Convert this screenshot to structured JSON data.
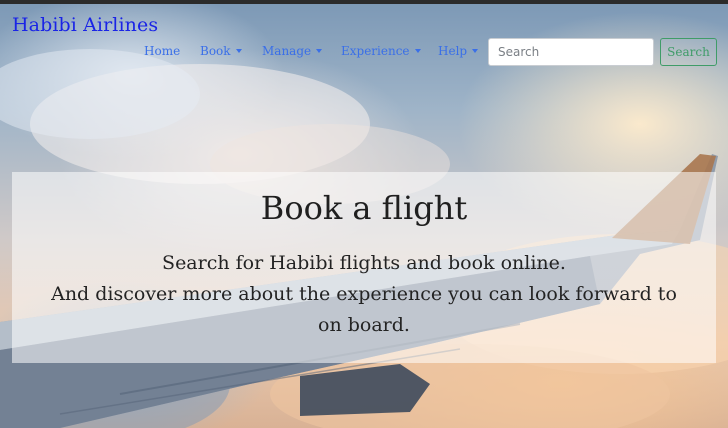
{
  "brand": {
    "name": "Habibi Airlines"
  },
  "nav": {
    "items": [
      {
        "label": "Home",
        "dropdown": false
      },
      {
        "label": "Book",
        "dropdown": true
      },
      {
        "label": "Manage",
        "dropdown": true
      },
      {
        "label": "Experience",
        "dropdown": true
      },
      {
        "label": "Help",
        "dropdown": true
      }
    ]
  },
  "search": {
    "placeholder": "Search",
    "value": "",
    "button_label": "Search"
  },
  "hero": {
    "title": "Book a flight",
    "lines": [
      "Search for Habibi flights and book online.",
      "And discover more about the experience you can look forward to",
      "on board."
    ]
  },
  "colors": {
    "brand": "#1a24e6",
    "nav_link": "#3a6fe8",
    "search_button": "#3f9c68",
    "panel_overlay": "rgba(255,255,255,0.55)"
  }
}
